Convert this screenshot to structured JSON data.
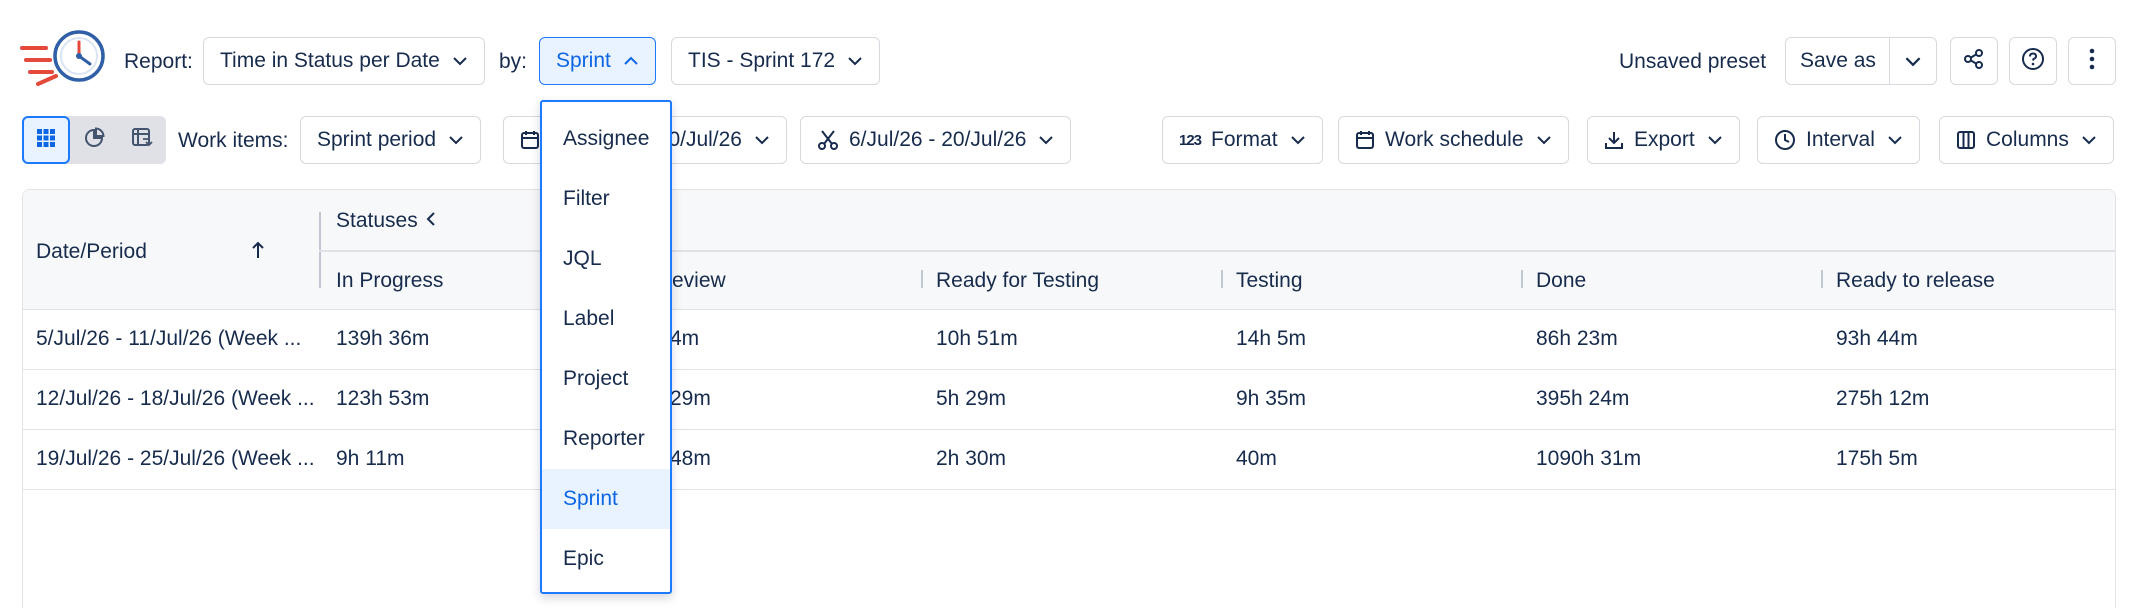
{
  "header": {
    "report_label": "Report:",
    "report_value": "Time in Status per Date",
    "by_label": "by:",
    "by_value": "Sprint",
    "sprint_value": "TIS - Sprint 172",
    "preset_status": "Unsaved preset",
    "save_as_label": "Save as"
  },
  "toolbar": {
    "work_items_label": "Work items:",
    "work_items_value": "Sprint period",
    "date_range_partial": "0/Jul/26",
    "cut_range": "6/Jul/26 - 20/Jul/26",
    "format_label": "Format",
    "work_schedule_label": "Work schedule",
    "export_label": "Export",
    "interval_label": "Interval",
    "columns_label": "Columns"
  },
  "table": {
    "date_header": "Date/Period",
    "statuses_header": "Statuses",
    "columns": [
      "In Progress",
      "review",
      "Ready for Testing",
      "Testing",
      "Done",
      "Ready to release"
    ],
    "rows": [
      {
        "period": "5/Jul/26 - 11/Jul/26 (Week ...",
        "values": [
          "139h 36m",
          "4m",
          "10h 51m",
          "14h 5m",
          "86h 23m",
          "93h 44m"
        ]
      },
      {
        "period": "12/Jul/26 - 18/Jul/26 (Week ...",
        "values": [
          "123h 53m",
          "29m",
          "5h 29m",
          "9h 35m",
          "395h 24m",
          "275h 12m"
        ]
      },
      {
        "period": "19/Jul/26 - 25/Jul/26 (Week ...",
        "values": [
          "9h 11m",
          "48m",
          "2h 30m",
          "40m",
          "1090h 31m",
          "175h 5m"
        ]
      }
    ]
  },
  "dropdown": {
    "options": [
      "Assignee",
      "Filter",
      "JQL",
      "Label",
      "Project",
      "Reporter",
      "Sprint",
      "Epic"
    ],
    "selected": "Sprint"
  },
  "colors": {
    "accent": "#0c66e4",
    "accent_border": "#1d7afc",
    "selected_bg": "#e9f2ff",
    "logo_red": "#e5493a",
    "logo_blue": "#2f5fa7"
  }
}
